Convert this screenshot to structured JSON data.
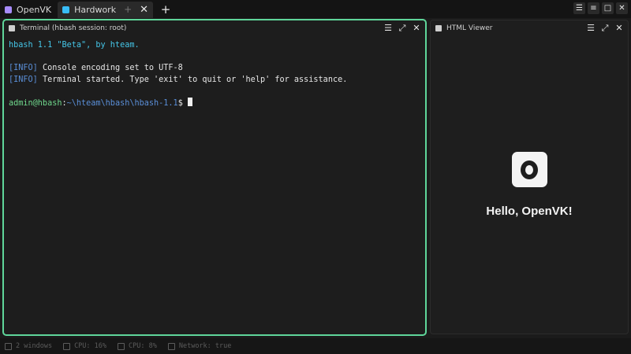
{
  "tabs": [
    {
      "label": "OpenVK"
    },
    {
      "label": "Hardwork"
    }
  ],
  "tab_controls": {
    "pin_glyph": "+",
    "close_glyph": "✕",
    "new_glyph": "+"
  },
  "window_controls": {
    "menu": "☰",
    "list": "≡",
    "maximize": "□",
    "close": "✕"
  },
  "terminal": {
    "title": "Terminal (hbash session: root)",
    "menu_glyph": "☰",
    "expand_glyph": "⤢",
    "close_glyph": "✕",
    "banner": "hbash 1.1 \"Beta\", by hteam.",
    "info_tag": "[INFO]",
    "log_lines": [
      " Console encoding set to UTF-8",
      " Terminal started. Type 'exit' to quit or 'help' for assistance."
    ],
    "prompt_user": "admin@hbash",
    "prompt_sep": ":",
    "prompt_path": "~\\hteam\\hbash\\hbash-1.1",
    "prompt_end": "$ "
  },
  "viewer": {
    "title": "HTML Viewer",
    "menu_glyph": "☰",
    "expand_glyph": "⤢",
    "close_glyph": "✕",
    "heading": "Hello, OpenVK!"
  },
  "status": {
    "windows": "2 windows",
    "cpu1": "CPU: 16%",
    "cpu2": "CPU: 8%",
    "network": "Network: true"
  },
  "colors": {
    "active_border": "#5fd69a",
    "terminal_cyan": "#45c6e8",
    "info_blue": "#5a8fd8",
    "prompt_green": "#6fd78c"
  }
}
